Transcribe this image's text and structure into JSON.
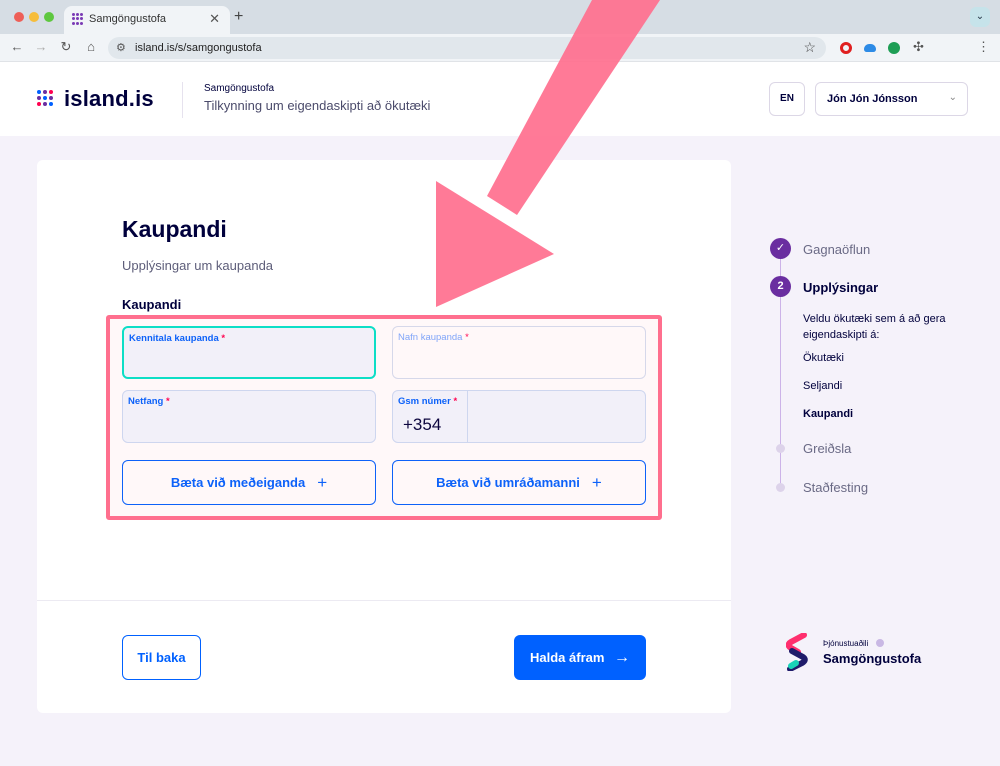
{
  "browser": {
    "tab_title": "Samgöngustofa",
    "url": "island.is/s/samgongustofa",
    "new_tab_icon": "+",
    "close_icon": "✕",
    "menu_icon": "⌄"
  },
  "header": {
    "logo_text": "island.is",
    "org_name": "Samgöngustofa",
    "form_name": "Tilkynning um eigendaskipti að ökutæki",
    "lang_button": "EN",
    "user_name": "Jón Jón Jónsson"
  },
  "main": {
    "title": "Kaupandi",
    "subtitle": "Upplýsingar um kaupanda",
    "section_label": "Kaupandi",
    "fields": {
      "national_id_label": "Kennitala kaupanda",
      "name_label": "Nafn kaupanda",
      "email_label": "Netfang",
      "phone_label": "Gsm númer",
      "phone_prefix": "+354",
      "required_mark": "*"
    },
    "add_co_owner": "Bæta við meðeiganda",
    "add_operator": "Bæta við umráðamanni",
    "back_button": "Til baka",
    "next_button": "Halda áfram"
  },
  "stepper": {
    "steps": [
      {
        "label": "Gagnaöflun",
        "state": "done"
      },
      {
        "label": "Upplýsingar",
        "number": "2",
        "state": "active"
      },
      {
        "label": "Greiðsla",
        "state": "future"
      },
      {
        "label": "Staðfesting",
        "state": "future"
      }
    ],
    "substep_description": "Veldu ökutæki sem á að gera eigendaskipti á:",
    "substeps": [
      "Ökutæki",
      "Seljandi",
      "Kaupandi"
    ]
  },
  "provider": {
    "label": "Þjónustuaðili",
    "name": "Samgöngustofa"
  },
  "colors": {
    "primary": "#0061ff",
    "brand_purple": "#6a2ea0",
    "highlight": "#ff6f8e",
    "focus_border": "#00e4ca"
  }
}
